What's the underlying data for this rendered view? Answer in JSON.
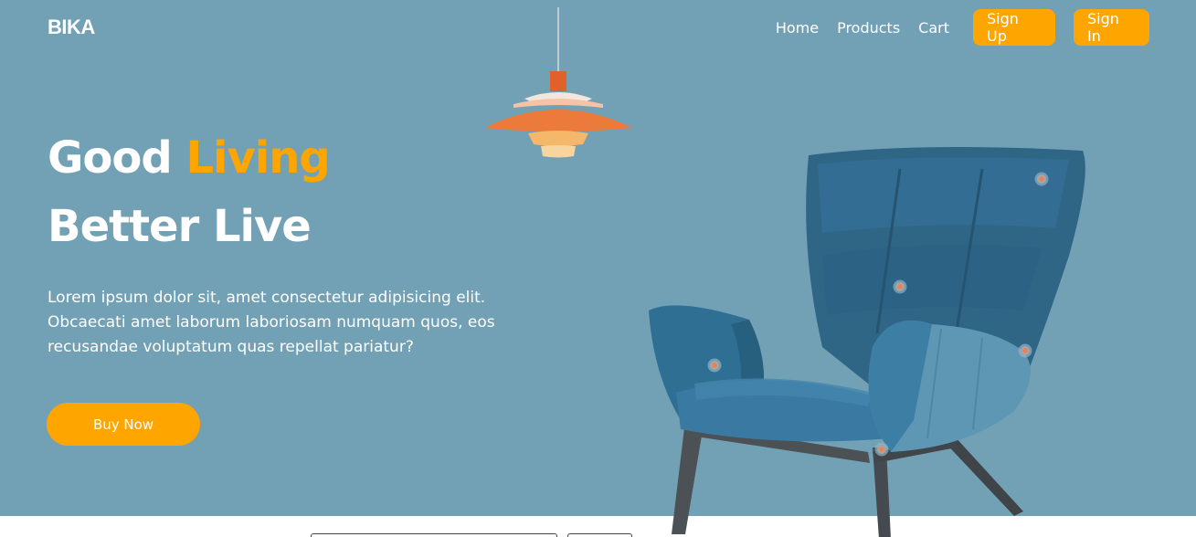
{
  "brand": "BIKA",
  "nav": {
    "links": [
      "Home",
      "Products",
      "Cart"
    ],
    "signup_label": "Sign Up",
    "signin_label": "Sign In"
  },
  "hero": {
    "headline_part1": "Good",
    "headline_accent": "Living",
    "headline_line2": "Better Live",
    "description": "Lorem ipsum dolor sit, amet consectetur adipisicing elit. Obcaecati amet laborum laboriosam numquam quos, eos recusandae voluptatum quas repellat pariatur?",
    "cta_label": "Buy Now"
  },
  "colors": {
    "hero_background": "#72a1b6",
    "accent": "#ffa500",
    "text": "#ffffff",
    "chair": "#3b7294"
  },
  "icons": {
    "lamp": "pendant-lamp-illustration",
    "chair": "armchair-illustration"
  }
}
